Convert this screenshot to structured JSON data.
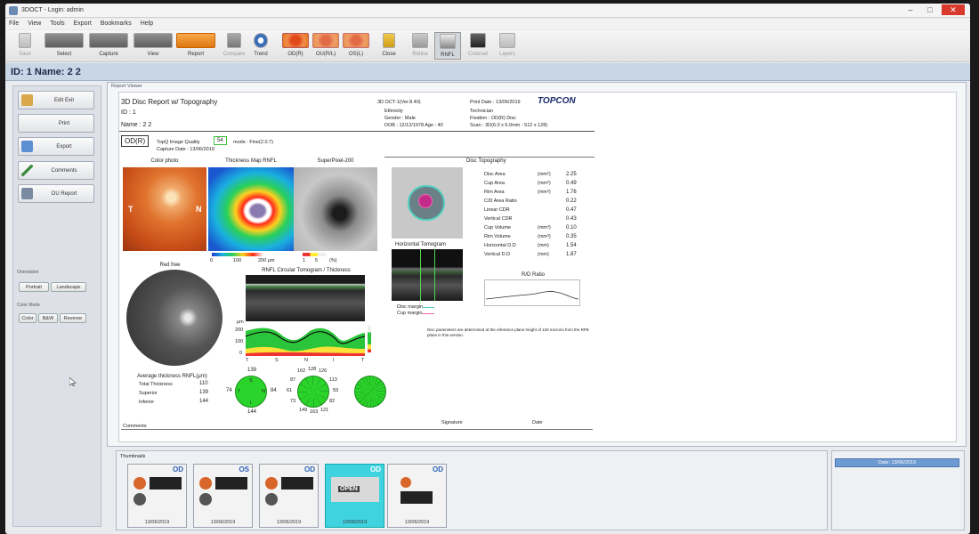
{
  "window": {
    "title": "3DOCT - Login: admin"
  },
  "menu": [
    "File",
    "View",
    "Tools",
    "Export",
    "Bookmarks",
    "Help"
  ],
  "toolbar": {
    "save": "Save",
    "select": "Select",
    "capture": "Capture",
    "view": "View",
    "report": "Report",
    "compare": "Compare",
    "trend": "Trend",
    "od": "OD(R)",
    "ou": "OU(R/L)",
    "os": "OS(L)",
    "close": "Close",
    "retina": "Retina",
    "rnfl": "RNFL",
    "colorset": "Colorset",
    "layers": "Layers"
  },
  "patient_bar": "ID: 1   Name: 2 2",
  "sidebar": {
    "edit_exit": "Edit Exit",
    "print": "Print",
    "export": "Export",
    "comments": "Comments",
    "ou_report": "OU Report",
    "orientation": "Orientation",
    "portrait": "Portrait",
    "landscape": "Landscape",
    "color_mode": "Color Mode",
    "color": "Color",
    "bw": "B&W",
    "reverse": "Reverse"
  },
  "viewer": {
    "header": "Report Viewer"
  },
  "report": {
    "title": "3D Disc Report w/ Topography",
    "id": "ID : 1",
    "name": "Name : 2 2",
    "device": "3D OCT-1(Ver.8.40)",
    "ethnicity": "Ethnicity",
    "gender": "Gender : Male",
    "dob": "DOB : 12/12/1978   Age : 40",
    "print_date": "Print Date : 13/06/2019",
    "brand": "TOPCON",
    "technician": "Technician",
    "fixation": "Fixation : OD(R) Disc",
    "scan": "Scan : 3D(6.0 x 6.0mm - 512 x 128)",
    "eye": "OD(R)",
    "quality_label": "TopQ Image Quality",
    "quality": "54",
    "mode": "mode : Fine(2.0.7)",
    "capture_date": "Capture Date : 13/06/2019",
    "color_photo": "Color photo",
    "thickness_map": "Thickness Map RNFL",
    "superpixel": "SuperPixel-200",
    "t_label": "T",
    "n_label": "N",
    "scale_thick": [
      "0",
      "100",
      "200 μm"
    ],
    "scale_sp": [
      "1",
      "5",
      "(%)"
    ],
    "disc_topo": "Disc Topography",
    "topo_rows": [
      {
        "label": "Disc Area",
        "unit": "(mm²)",
        "value": "2.25"
      },
      {
        "label": "Cup Area",
        "unit": "(mm²)",
        "value": "0.49"
      },
      {
        "label": "Rim Area",
        "unit": "(mm²)",
        "value": "1.76"
      },
      {
        "label": "C/D Area Ratio",
        "unit": "",
        "value": "0.22"
      },
      {
        "label": "Linear CDR",
        "unit": "",
        "value": "0.47"
      },
      {
        "label": "Vertical CDR",
        "unit": "",
        "value": "0.43"
      },
      {
        "label": "Cup Volume",
        "unit": "(mm³)",
        "value": "0.10"
      },
      {
        "label": "Rim Volume",
        "unit": "(mm³)",
        "value": "0.35"
      },
      {
        "label": "Horizontal D.D",
        "unit": "(mm)",
        "value": "1.54"
      },
      {
        "label": "Vertical D.D",
        "unit": "(mm)",
        "value": "1.87"
      }
    ],
    "horiz_tomogram": "Horizontal Tomogram",
    "disc_margin": "Disc margin",
    "cup_margin": "Cup margin",
    "rd_ratio": "R/D Ratio",
    "red_free": "Red free",
    "circ_tomogram": "RNFL Circular Tomogram / Thickness",
    "axis_unit": "μm",
    "axis_ticks": [
      "200",
      "100",
      "0"
    ],
    "tsnit": [
      "T",
      "S",
      "N",
      "I",
      "T"
    ],
    "disc_note": "Disc parameters are determined at the reference plane height of 120 microns from the RPE plane in this version.",
    "avg_title": "Average thickness RNFL(μm)",
    "avg_rows": [
      {
        "label": "Total Thickness",
        "value": "110"
      },
      {
        "label": "Superior",
        "value": "139"
      },
      {
        "label": "Inferior",
        "value": "144"
      }
    ],
    "quad": {
      "top": "139",
      "left": "74",
      "right": "84",
      "bottom": "144",
      "s": "S",
      "n": "N",
      "i": "I",
      "t": "T"
    },
    "clock": {
      "a": "162",
      "b": "128",
      "c": "126",
      "d": "87",
      "e": "113",
      "f": "61",
      "g": "59",
      "h": "73",
      "i": "82",
      "j": "149",
      "k": "163",
      "l": "121"
    },
    "comments": "Comments",
    "signature": "Signature",
    "date": "Date"
  },
  "thumbnails": {
    "label": "Thumbnails",
    "items": [
      {
        "tag": "OD",
        "date": "13/06/2019"
      },
      {
        "tag": "OS",
        "date": "13/06/2019"
      },
      {
        "tag": "OD",
        "date": "13/06/2019"
      },
      {
        "tag": "OD",
        "date": "13/06/2019",
        "badge": "OPEN"
      },
      {
        "tag": "OD",
        "date": "13/06/2019"
      }
    ]
  },
  "date_panel": "Date: 13/06/2019",
  "colors": {
    "accent": "#f08a24",
    "selected": "#3fd3e0",
    "title_bar": "#c9d6e6",
    "brand": "#1b2a6b"
  }
}
